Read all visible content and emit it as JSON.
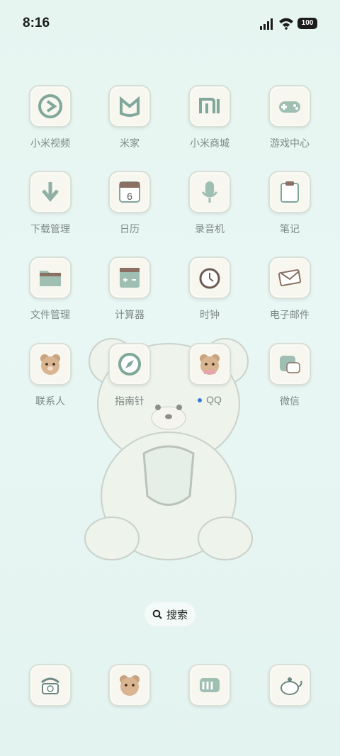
{
  "status_bar": {
    "time": "8:16",
    "battery": "100"
  },
  "apps": [
    {
      "label": "小米视频",
      "icon": "play-circle-icon"
    },
    {
      "label": "米家",
      "icon": "mijia-icon"
    },
    {
      "label": "小米商城",
      "icon": "mi-logo-icon"
    },
    {
      "label": "游戏中心",
      "icon": "gamepad-icon"
    },
    {
      "label": "下载管理",
      "icon": "download-arrow-icon"
    },
    {
      "label": "日历",
      "icon": "calendar-icon",
      "day": "6"
    },
    {
      "label": "录音机",
      "icon": "microphone-icon"
    },
    {
      "label": "笔记",
      "icon": "clipboard-note-icon"
    },
    {
      "label": "文件管理",
      "icon": "folder-icon"
    },
    {
      "label": "计算器",
      "icon": "calculator-icon"
    },
    {
      "label": "时钟",
      "icon": "clock-icon"
    },
    {
      "label": "电子邮件",
      "icon": "envelope-icon"
    },
    {
      "label": "联系人",
      "icon": "bear-contact-icon"
    },
    {
      "label": "指南针",
      "icon": "compass-icon"
    },
    {
      "label": "QQ",
      "icon": "bear-qq-icon"
    },
    {
      "label": "微信",
      "icon": "wechat-icon"
    }
  ],
  "search": {
    "label": "搜索"
  },
  "dock": [
    {
      "icon": "telephone-icon"
    },
    {
      "icon": "bear-messages-icon"
    },
    {
      "icon": "browser-icon"
    },
    {
      "icon": "teapot-camera-icon"
    }
  ]
}
